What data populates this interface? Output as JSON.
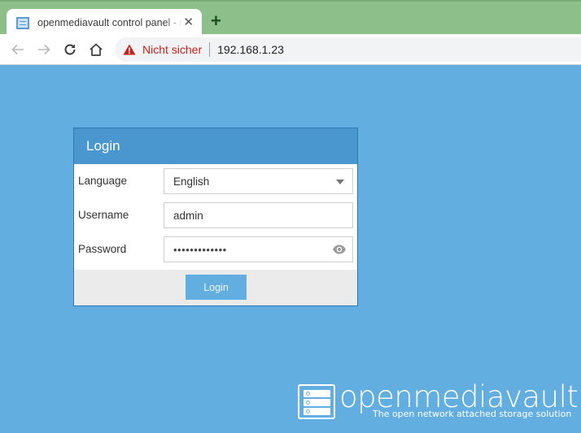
{
  "browser": {
    "tab": {
      "title": "openmediavault control panel - r",
      "favicon": "openmediavault-favicon",
      "close_glyph": "✕"
    },
    "new_tab_glyph": "+",
    "nav": {
      "back_icon": "arrow-left-icon",
      "forward_icon": "arrow-right-icon",
      "reload_icon": "reload-icon",
      "home_icon": "home-icon"
    },
    "omnibox": {
      "security_icon": "warning-triangle-icon",
      "security_label": "Nicht sicher",
      "url": "192.168.1.23"
    }
  },
  "colors": {
    "page_background": "#63aee0",
    "panel_header": "#4a96cf",
    "tabstrip": "#8dbf8a",
    "not_secure": "#c5221f"
  },
  "login": {
    "title": "Login",
    "fields": {
      "language": {
        "label": "Language",
        "value": "English"
      },
      "username": {
        "label": "Username",
        "value": "admin"
      },
      "password": {
        "label": "Password",
        "value": "•••••••••••••",
        "reveal_icon": "eye-icon"
      }
    },
    "submit_label": "Login"
  },
  "branding": {
    "wordmark": "openmediavault",
    "tagline": "The open network attached storage solution"
  }
}
